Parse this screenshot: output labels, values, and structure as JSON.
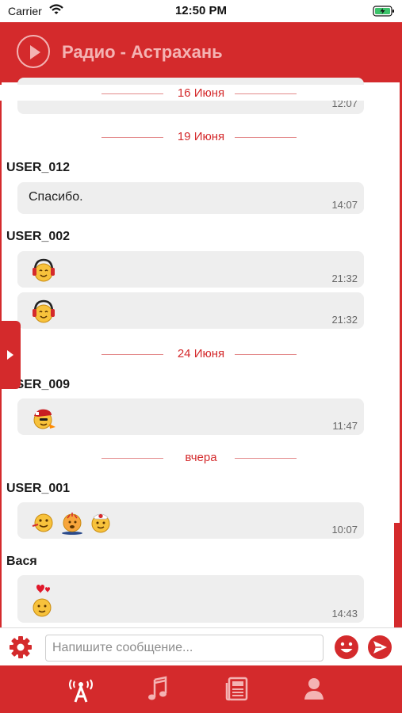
{
  "status_bar": {
    "carrier": "Carrier",
    "time": "12:50 PM"
  },
  "header": {
    "title": "Радио - Астрахань"
  },
  "chat": {
    "partial_message_time": "12:07",
    "dates": [
      "16 Июня",
      "19 Июня",
      "24 Июня",
      "вчера"
    ],
    "messages": [
      {
        "sender": "USER_012",
        "text": "Спасибо.",
        "time": "14:07"
      },
      {
        "sender": "USER_002",
        "time": "21:32",
        "emoji": [
          "headphones-smiley-icon"
        ]
      },
      {
        "sender": "",
        "time": "21:32",
        "emoji": [
          "headphones-smiley-icon"
        ]
      },
      {
        "sender": "USER_009",
        "time": "11:47",
        "emoji": [
          "cap-smiley-icon"
        ]
      },
      {
        "sender": "USER_001",
        "time": "10:07",
        "emoji": [
          "smiley-icon",
          "bouncing-smiley-icon",
          "nurse-smiley-icon"
        ]
      },
      {
        "sender": "Вася",
        "time": "14:43",
        "emoji": [
          "love-smiley-icon"
        ]
      }
    ]
  },
  "compose": {
    "placeholder": "Напишите сообщение..."
  },
  "tabs": [
    "radio-icon",
    "music-icon",
    "news-icon",
    "profile-icon"
  ],
  "colors": {
    "brand_red": "#d42a2c",
    "bubble_gray": "#eeeeee",
    "title_pink": "#f4b3b3"
  }
}
